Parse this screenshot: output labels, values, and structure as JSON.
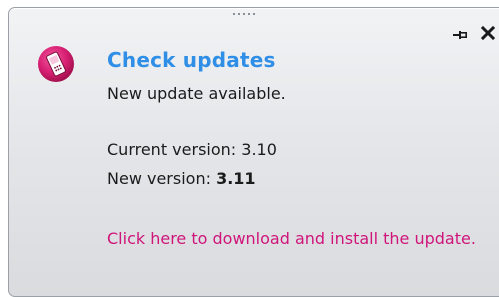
{
  "popup": {
    "title": "Check updates",
    "subtitle": "New update available.",
    "current_version_label": "Current version: ",
    "current_version_value": "3.10",
    "new_version_label": "New version: ",
    "new_version_value": "3.11",
    "download_link": "Click here to download and install the update."
  },
  "icons": {
    "app": "mobile-phone-icon",
    "pin": "pin-icon",
    "close": "close-icon"
  },
  "colors": {
    "title": "#2f8ee6",
    "link": "#d0157a",
    "app_icon": "#d81f73",
    "text": "#1b1b1b"
  }
}
